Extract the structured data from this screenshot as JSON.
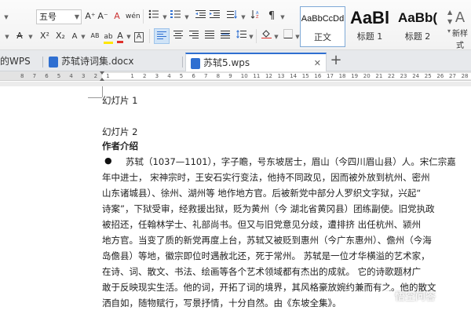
{
  "ribbon": {
    "font_size": "五号",
    "grow_label": "A⁺",
    "shrink_label": "A⁻",
    "clear_format_label": "A",
    "pinyin_label": "wén",
    "superscript_label": "X²",
    "subscript_label": "X₂",
    "char_border_label": "A",
    "char_shade_label": "AB",
    "highlight_label": "ab",
    "font_color_label": "A",
    "char_box_label": "A",
    "styles": [
      {
        "sample": "AaBbCcDd",
        "label": "正文"
      },
      {
        "sample": "AaBl",
        "label": "标题 1"
      },
      {
        "sample": "AaBb(",
        "label": "标题 2"
      }
    ],
    "new_style_label": "新样式",
    "accent_color": "#2f6fd1",
    "font_color_bar": "#e0312b",
    "highlight_bar": "#ffe600"
  },
  "tabs": [
    {
      "label": "的WPS",
      "active": false
    },
    {
      "label": "苏轼诗词集.docx",
      "active": false
    },
    {
      "label": "苏轼5.wps",
      "active": true
    }
  ],
  "tab_add_label": "+",
  "ruler": {
    "numbers": [
      "8",
      "7",
      "6",
      "5",
      "4",
      "3",
      "2",
      "1",
      "",
      "1",
      "2",
      "3",
      "4",
      "5",
      "6",
      "7",
      "8",
      "9",
      "10",
      "11",
      "12",
      "13",
      "14",
      "15",
      "16",
      "17",
      "18",
      "19",
      "20",
      "21",
      "22",
      "23",
      "24",
      "25",
      "26",
      "27",
      "28"
    ]
  },
  "document": {
    "lines": {
      "slide1": "幻灯片 1",
      "slide2": "幻灯片 2",
      "heading": "作者介绍"
    },
    "bullet": "●",
    "body": [
      "苏轼（1037—1101），字子瞻，号东坡居士，眉山（今四川眉山县）人。宋仁宗嘉",
      "年中进士， 宋神宗时，王安石实行变法，他持不同政见，因而被外放到杭州、密州",
      "山东诸城县）、徐州、湖州等 地作地方官。后被新党中部分人罗织文字狱，兴起“",
      "诗案”，下狱受审，经救援出狱，贬为黄州（今 湖北省黄冈县）团练副使。旧党执政",
      "被招还，任翰林学士、礼部尚书。但又与旧党意见分歧，遭排挤 出任杭州、颍州",
      "地方官。当变了质的新党再度上台，苏轼又被贬到惠州（今广东惠州）、儋州（今海",
      "岛儋县）等地，徽宗即位时遇赦北还，死于常州。 苏轼是一位才华横溢的艺术家，",
      "在诗、词、散文、书法、绘画等各个艺术领域都有杰出的成就。  它的诗歌题材广",
      "敢于反映现实生活。他的词，开拓了词的境界，其风格豪放婉约兼而有之。他的散文",
      "洒自如，随物赋行，写景抒情，十分自然。由《东坡全集》。"
    ]
  },
  "watermark": "悟空问答"
}
